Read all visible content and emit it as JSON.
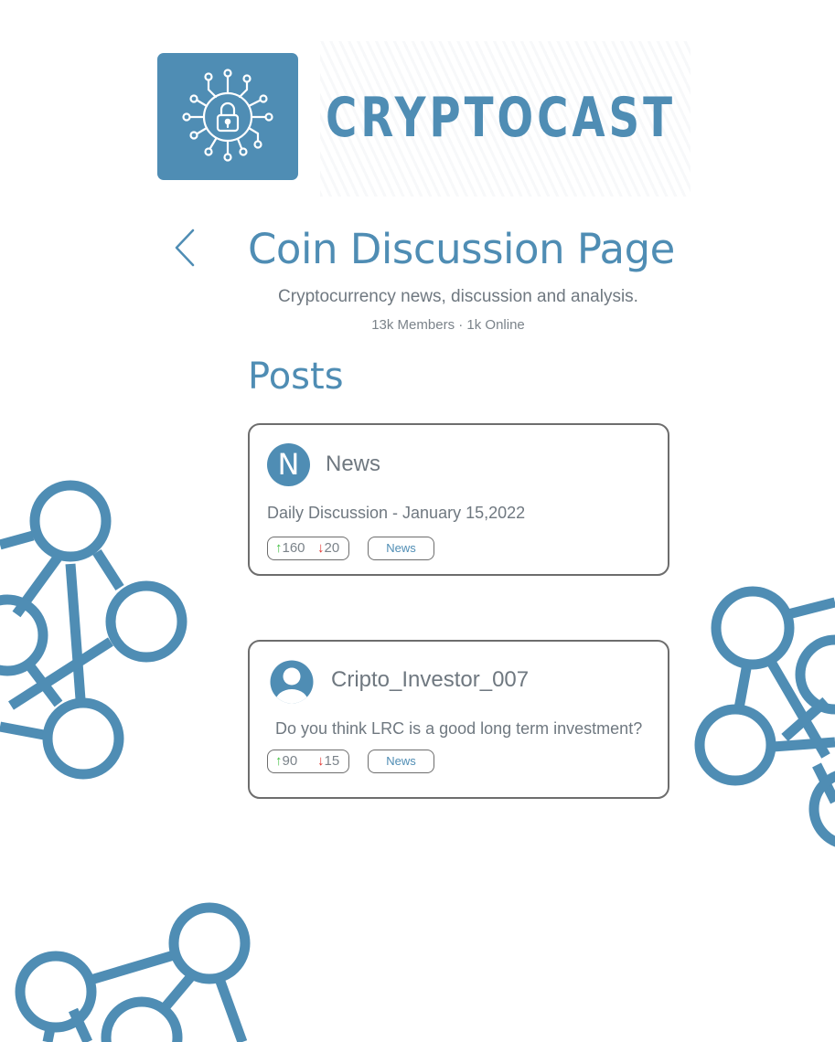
{
  "brand": {
    "name": "CRYPTOCAST"
  },
  "header": {
    "title": "Coin Discussion Page",
    "subtitle": "Cryptocurrency news, discussion and analysis.",
    "stats": "13k Members · 1k Online"
  },
  "posts_heading": "Posts",
  "posts": [
    {
      "avatar_letter": "N",
      "author": "News",
      "text": "Daily Discussion - January 15,2022",
      "upvotes": "160",
      "downvotes": "20",
      "tag": "News"
    },
    {
      "avatar_icon": "user-icon",
      "author": "Cripto_Investor_007",
      "text": "Do you think LRC is a good long term investment?",
      "upvotes": "90",
      "downvotes": "15",
      "tag": "News"
    }
  ],
  "icons": {
    "back": "chevron-left-icon",
    "upvote": "arrow-up-icon",
    "downvote": "arrow-down-icon",
    "logo": "padlock-circuit-icon",
    "decoration": "network-nodes-icon"
  },
  "colors": {
    "accent": "#4f8db4",
    "text": "#6f7880",
    "border": "#6d6d6d",
    "upvote": "#3fbf3f",
    "downvote": "#e0322d"
  }
}
